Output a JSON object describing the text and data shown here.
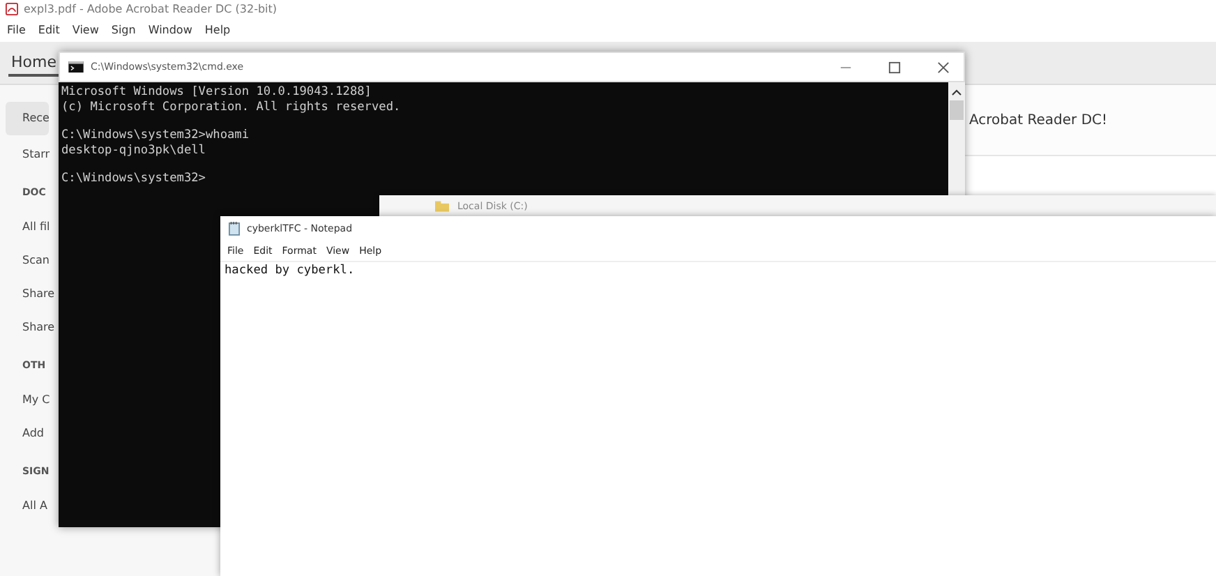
{
  "acrobat": {
    "title": "expl3.pdf - Adobe Acrobat Reader DC (32-bit)",
    "menu": [
      "File",
      "Edit",
      "View",
      "Sign",
      "Window",
      "Help"
    ],
    "tabs": [
      {
        "label": "Home",
        "selected": true
      }
    ],
    "sidebar": [
      {
        "kind": "item",
        "label": "Rece",
        "selected": true
      },
      {
        "kind": "item",
        "label": "Starr",
        "selected": false
      },
      {
        "kind": "header",
        "label": "DOC"
      },
      {
        "kind": "item",
        "label": "All fil",
        "selected": false
      },
      {
        "kind": "item",
        "label": "Scan",
        "selected": false
      },
      {
        "kind": "item",
        "label": "Share",
        "selected": false
      },
      {
        "kind": "item",
        "label": "Share",
        "selected": false
      },
      {
        "kind": "header",
        "label": "OTH"
      },
      {
        "kind": "item",
        "label": "My C",
        "selected": false
      },
      {
        "kind": "item",
        "label": "Add",
        "selected": false
      },
      {
        "kind": "header",
        "label": "SIGN"
      },
      {
        "kind": "item",
        "label": "All A",
        "selected": false
      }
    ],
    "banner": "Acrobat Reader DC!"
  },
  "cmd": {
    "title": "C:\\Windows\\system32\\cmd.exe",
    "blocks": [
      [
        "Microsoft Windows [Version 10.0.19043.1288]",
        "(c) Microsoft Corporation. All rights reserved."
      ],
      [
        "C:\\Windows\\system32>whoami",
        "desktop-qjno3pk\\dell"
      ],
      [
        "C:\\Windows\\system32>"
      ]
    ]
  },
  "explorer": {
    "location": "Local Disk (C:)"
  },
  "notepad": {
    "title": "cyberklTFC - Notepad",
    "menu": [
      "File",
      "Edit",
      "Format",
      "View",
      "Help"
    ],
    "text": "hacked by cyberkl."
  }
}
